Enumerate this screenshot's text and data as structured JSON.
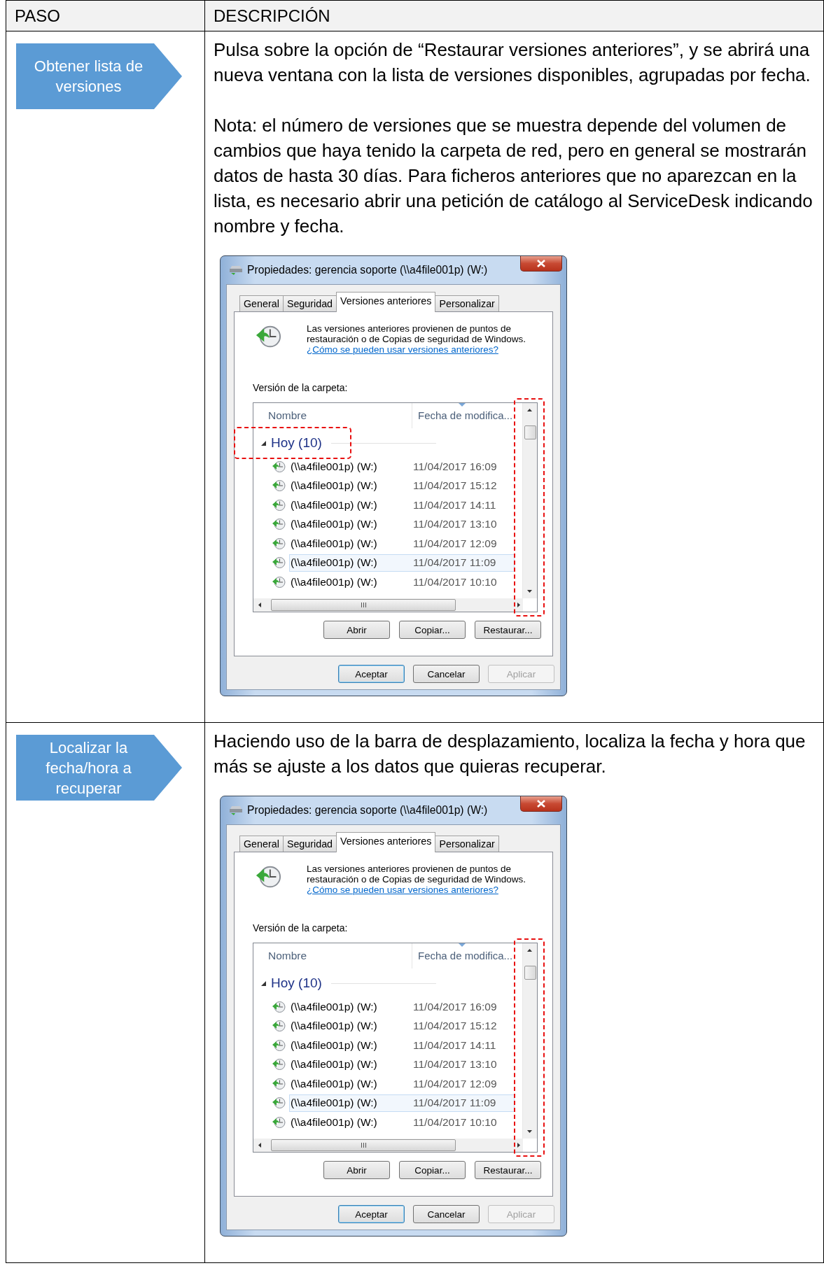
{
  "table": {
    "columns": [
      "PASO",
      "DESCRIPCIÓN"
    ],
    "rows": [
      {
        "step": "Obtener lista de versiones",
        "paragraphs": [
          "Pulsa sobre la opción de “Restaurar versiones anteriores”, y se abrirá una nueva ventana con la lista de versiones disponibles, agrupadas por fecha.",
          "Nota: el número de versiones que se muestra depende del volumen de cambios que haya tenido la carpeta de red, pero en general se mostrarán datos de hasta 30 días. Para ficheros anteriores que no aparezcan en la lista, es necesario abrir una petición de catálogo al ServiceDesk indicando nombre y fecha."
        ],
        "dialog": {
          "title": "Propiedades: gerencia soporte (\\\\a4file001p) (W:)",
          "tabs": [
            {
              "label": "General",
              "selected": false
            },
            {
              "label": "Seguridad",
              "selected": false
            },
            {
              "label": "Versiones anteriores",
              "selected": true
            },
            {
              "label": "Personalizar",
              "selected": false
            }
          ],
          "info": "Las versiones anteriores provienen de puntos de restauración o de Copias de seguridad de Windows.",
          "link": "¿Cómo se pueden usar versiones anteriores?",
          "folder_label": "Versión de la carpeta:",
          "columns": [
            {
              "label": "Nombre",
              "sorted": false
            },
            {
              "label": "Fecha de modifica...",
              "sorted": true
            }
          ],
          "group": {
            "label": "Hoy (10)",
            "expanded": true
          },
          "rows": [
            {
              "name": "(\\\\a4file001p) (W:)",
              "date": "11/04/2017 16:09",
              "selected": false
            },
            {
              "name": "(\\\\a4file001p) (W:)",
              "date": "11/04/2017 15:12",
              "selected": false
            },
            {
              "name": "(\\\\a4file001p) (W:)",
              "date": "11/04/2017 14:11",
              "selected": false
            },
            {
              "name": "(\\\\a4file001p) (W:)",
              "date": "11/04/2017 13:10",
              "selected": false
            },
            {
              "name": "(\\\\a4file001p) (W:)",
              "date": "11/04/2017 12:09",
              "selected": false
            },
            {
              "name": "(\\\\a4file001p) (W:)",
              "date": "11/04/2017 11:09",
              "selected": true
            },
            {
              "name": "(\\\\a4file001p) (W:)",
              "date": "11/04/2017 10:10",
              "selected": false
            }
          ],
          "actions": [
            "Abrir",
            "Copiar...",
            "Restaurar..."
          ],
          "buttons": [
            {
              "label": "Aceptar",
              "default": true,
              "disabled": false
            },
            {
              "label": "Cancelar",
              "default": false,
              "disabled": false
            },
            {
              "label": "Aplicar",
              "default": false,
              "disabled": true
            }
          ],
          "highlight_group": true,
          "highlight_scrollbar": true
        }
      },
      {
        "step": "Localizar la fecha/hora a recuperar",
        "paragraphs": [
          "Haciendo uso de la barra de desplazamiento, localiza la fecha y hora que más se ajuste a los datos que quieras recuperar."
        ],
        "dialog": {
          "title": "Propiedades: gerencia soporte (\\\\a4file001p) (W:)",
          "tabs": [
            {
              "label": "General",
              "selected": false
            },
            {
              "label": "Seguridad",
              "selected": false
            },
            {
              "label": "Versiones anteriores",
              "selected": true
            },
            {
              "label": "Personalizar",
              "selected": false
            }
          ],
          "info": "Las versiones anteriores provienen de puntos de restauración o de Copias de seguridad de Windows.",
          "link": "¿Cómo se pueden usar versiones anteriores?",
          "folder_label": "Versión de la carpeta:",
          "columns": [
            {
              "label": "Nombre",
              "sorted": false
            },
            {
              "label": "Fecha de modifica...",
              "sorted": true
            }
          ],
          "group": {
            "label": "Hoy (10)",
            "expanded": true
          },
          "rows": [
            {
              "name": "(\\\\a4file001p) (W:)",
              "date": "11/04/2017 16:09",
              "selected": false
            },
            {
              "name": "(\\\\a4file001p) (W:)",
              "date": "11/04/2017 15:12",
              "selected": false
            },
            {
              "name": "(\\\\a4file001p) (W:)",
              "date": "11/04/2017 14:11",
              "selected": false
            },
            {
              "name": "(\\\\a4file001p) (W:)",
              "date": "11/04/2017 13:10",
              "selected": false
            },
            {
              "name": "(\\\\a4file001p) (W:)",
              "date": "11/04/2017 12:09",
              "selected": false
            },
            {
              "name": "(\\\\a4file001p) (W:)",
              "date": "11/04/2017 11:09",
              "selected": true
            },
            {
              "name": "(\\\\a4file001p) (W:)",
              "date": "11/04/2017 10:10",
              "selected": false
            }
          ],
          "actions": [
            "Abrir",
            "Copiar...",
            "Restaurar..."
          ],
          "buttons": [
            {
              "label": "Aceptar",
              "default": true,
              "disabled": false
            },
            {
              "label": "Cancelar",
              "default": false,
              "disabled": false
            },
            {
              "label": "Aplicar",
              "default": false,
              "disabled": true
            }
          ],
          "highlight_group": false,
          "highlight_scrollbar": true
        }
      }
    ]
  }
}
